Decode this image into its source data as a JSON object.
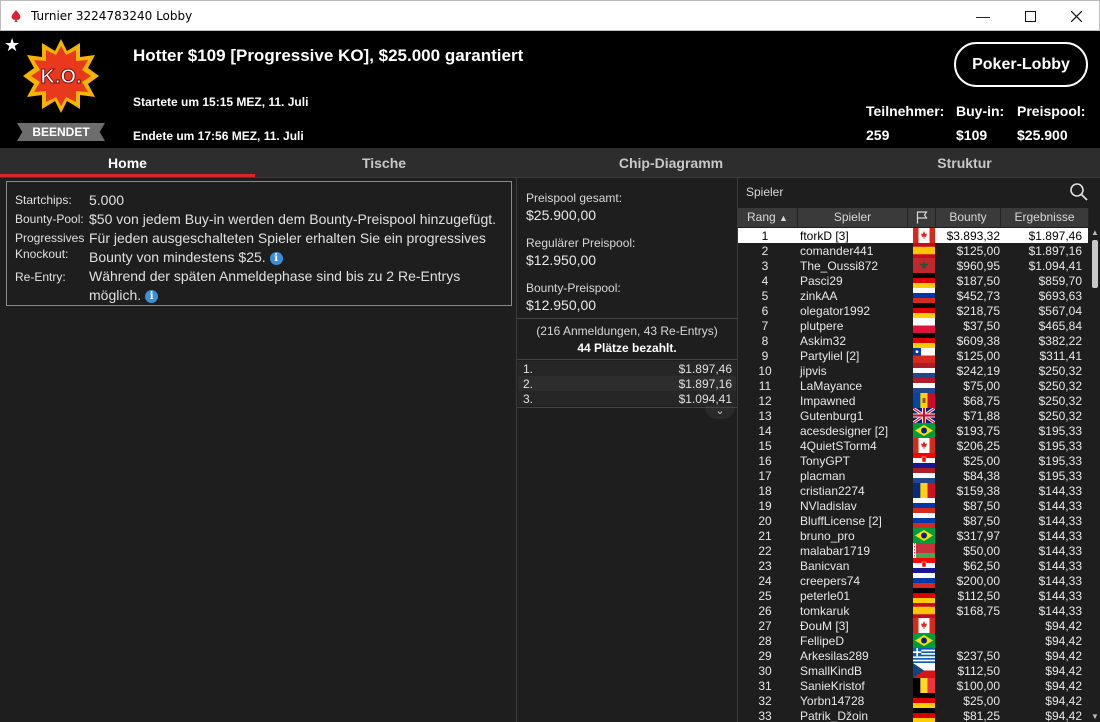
{
  "window": {
    "title": "Turnier 3224783240 Lobby"
  },
  "header": {
    "logo_text": "K.O.",
    "status": "BEENDET",
    "title": "Hotter $109 [Progressive KO], $25.000 garantiert",
    "started": "Startete um 15:15 MEZ, 11. Juli",
    "ended": "Endete um 17:56 MEZ, 11. Juli",
    "lobby_button": "Poker-Lobby",
    "stats": {
      "players_label": "Teilnehmer:",
      "players_value": "259",
      "buyin_label": "Buy-in:",
      "buyin_value": "$109",
      "pool_label": "Preispool:",
      "pool_value": "$25.900"
    }
  },
  "tabs": [
    "Home",
    "Tische",
    "Chip-Diagramm",
    "Struktur"
  ],
  "info": {
    "startchips_label": "Startchips:",
    "startchips_value": "5.000",
    "bountypool_label": "Bounty-Pool:",
    "bountypool_value": "$50 von jedem Buy-in werden dem Bounty-Preispool hinzugefügt.",
    "pko_label_1": "Progressives",
    "pko_label_2": "Knockout:",
    "pko_value_1": "Für jeden ausgeschalteten Spieler erhalten Sie ein progressives",
    "pko_value_2": "Bounty von mindestens $25.",
    "reentry_label": "Re-Entry:",
    "reentry_value_1": "Während der späten Anmeldephase sind bis zu 2 Re-Entrys",
    "reentry_value_2": "möglich."
  },
  "prizepool": {
    "total_label": "Preispool gesamt:",
    "total_value": "$25.900,00",
    "regular_label": "Regulärer Preispool:",
    "regular_value": "$12.950,00",
    "bounty_label": "Bounty-Preispool:",
    "bounty_value": "$12.950,00",
    "entries": "(216 Anmeldungen, 43 Re-Entrys)",
    "paid": "44 Plätze bezahlt.",
    "payouts": [
      {
        "place": "1.",
        "amount": "$1.897,46"
      },
      {
        "place": "2.",
        "amount": "$1.897,16"
      },
      {
        "place": "3.",
        "amount": "$1.094,41"
      }
    ]
  },
  "players": {
    "search_placeholder": "Spieler",
    "columns": {
      "rank": "Rang",
      "player": "Spieler",
      "bounty": "Bounty",
      "result": "Ergebnisse"
    },
    "rows": [
      {
        "rank": "1",
        "name": "ftorkD [3]",
        "flag": "canada",
        "bounty": "$3.893,32",
        "result": "$1.897,46"
      },
      {
        "rank": "2",
        "name": "comander441",
        "flag": "spain",
        "bounty": "$125,00",
        "result": "$1.897,16"
      },
      {
        "rank": "3",
        "name": "The_Oussi872",
        "flag": "morocco",
        "bounty": "$960,95",
        "result": "$1.094,41"
      },
      {
        "rank": "4",
        "name": "Pasci29",
        "flag": "germany",
        "bounty": "$187,50",
        "result": "$859,70"
      },
      {
        "rank": "5",
        "name": "zinkAA",
        "flag": "russia",
        "bounty": "$452,73",
        "result": "$693,63"
      },
      {
        "rank": "6",
        "name": "olegator1992",
        "flag": "germany",
        "bounty": "$218,75",
        "result": "$567,04"
      },
      {
        "rank": "7",
        "name": "plutpere",
        "flag": "poland",
        "bounty": "$37,50",
        "result": "$465,84"
      },
      {
        "rank": "8",
        "name": "Askim32",
        "flag": "germany",
        "bounty": "$609,38",
        "result": "$382,22"
      },
      {
        "rank": "9",
        "name": "Partyliel [2]",
        "flag": "chile",
        "bounty": "$125,00",
        "result": "$311,41"
      },
      {
        "rank": "10",
        "name": "jipvis",
        "flag": "netherlands",
        "bounty": "$242,19",
        "result": "$250,32"
      },
      {
        "rank": "11",
        "name": "LaMayance",
        "flag": "netherlands",
        "bounty": "$75,00",
        "result": "$250,32"
      },
      {
        "rank": "12",
        "name": "Impawned",
        "flag": "moldova",
        "bounty": "$68,75",
        "result": "$250,32"
      },
      {
        "rank": "13",
        "name": "Gutenburg1",
        "flag": "uk",
        "bounty": "$71,88",
        "result": "$250,32"
      },
      {
        "rank": "14",
        "name": "acesdesigner [2]",
        "flag": "brazil",
        "bounty": "$193,75",
        "result": "$195,33"
      },
      {
        "rank": "15",
        "name": "4QuietSTorm4",
        "flag": "canada",
        "bounty": "$206,25",
        "result": "$195,33"
      },
      {
        "rank": "16",
        "name": "TonyGPT",
        "flag": "croatia",
        "bounty": "$25,00",
        "result": "$195,33"
      },
      {
        "rank": "17",
        "name": "placman",
        "flag": "netherlands",
        "bounty": "$84,38",
        "result": "$195,33"
      },
      {
        "rank": "18",
        "name": "cristian2274",
        "flag": "romania",
        "bounty": "$159,38",
        "result": "$144,33"
      },
      {
        "rank": "19",
        "name": "NVladislav",
        "flag": "russia",
        "bounty": "$87,50",
        "result": "$144,33"
      },
      {
        "rank": "20",
        "name": "BluffLicense [2]",
        "flag": "russia",
        "bounty": "$87,50",
        "result": "$144,33"
      },
      {
        "rank": "21",
        "name": "bruno_pro",
        "flag": "brazil",
        "bounty": "$317,97",
        "result": "$144,33"
      },
      {
        "rank": "22",
        "name": "malabar1719",
        "flag": "belarus",
        "bounty": "$50,00",
        "result": "$144,33"
      },
      {
        "rank": "23",
        "name": "Banicvan",
        "flag": "croatia",
        "bounty": "$62,50",
        "result": "$144,33"
      },
      {
        "rank": "24",
        "name": "creepers74",
        "flag": "russia",
        "bounty": "$200,00",
        "result": "$144,33"
      },
      {
        "rank": "25",
        "name": "peterle01",
        "flag": "germany",
        "bounty": "$112,50",
        "result": "$144,33"
      },
      {
        "rank": "26",
        "name": "tomkaruk",
        "flag": "spain",
        "bounty": "$168,75",
        "result": "$144,33"
      },
      {
        "rank": "27",
        "name": "ĐouM [3]",
        "flag": "canada",
        "bounty": "",
        "result": "$94,42"
      },
      {
        "rank": "28",
        "name": "FellipeD",
        "flag": "brazil",
        "bounty": "",
        "result": "$94,42"
      },
      {
        "rank": "29",
        "name": "Arkesilas289",
        "flag": "greece",
        "bounty": "$237,50",
        "result": "$94,42"
      },
      {
        "rank": "30",
        "name": "SmallKindB",
        "flag": "czech",
        "bounty": "$112,50",
        "result": "$94,42"
      },
      {
        "rank": "31",
        "name": "SanieKristof",
        "flag": "belgium",
        "bounty": "$100,00",
        "result": "$94,42"
      },
      {
        "rank": "32",
        "name": "Yorbn14728",
        "flag": "germany",
        "bounty": "$25,00",
        "result": "$94,42"
      },
      {
        "rank": "33",
        "name": "Patrik_Džoin",
        "flag": "germany",
        "bounty": "$81,25",
        "result": "$94,42"
      }
    ]
  },
  "colors": {
    "accent": "#d9232e",
    "info_icon": "#3a8fd6",
    "background": "#1e1e1e",
    "header": "#000000"
  }
}
